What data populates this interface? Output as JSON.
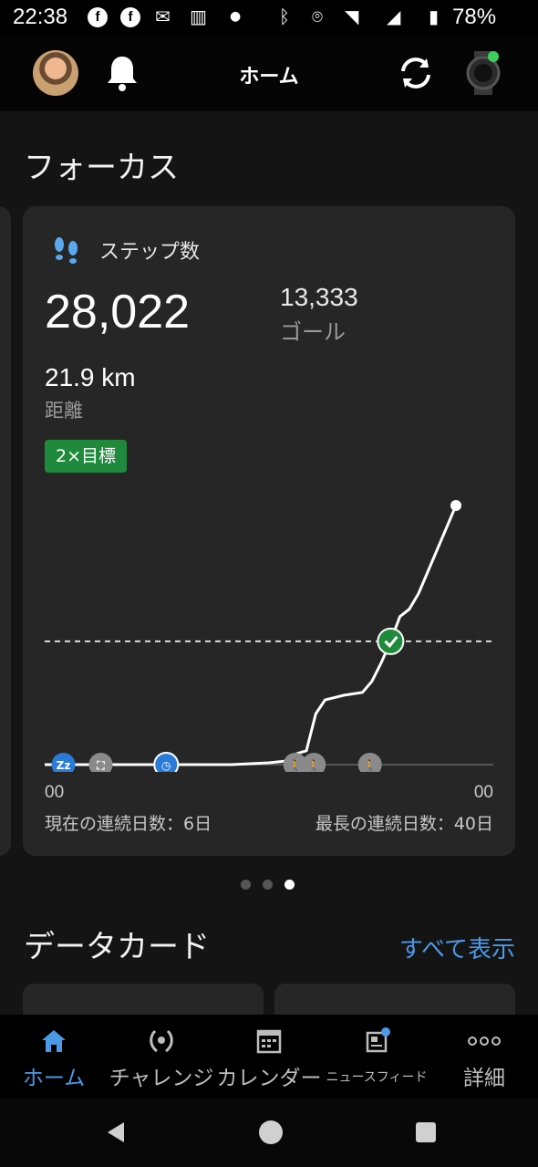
{
  "status_bar": {
    "time": "22:38",
    "battery": "78%"
  },
  "header": {
    "title": "ホーム"
  },
  "focus": {
    "section_title": "フォーカス",
    "card": {
      "title": "ステップ数",
      "steps": "28,022",
      "goal_value": "13,333",
      "goal_label": "ゴール",
      "distance_value": "21.9 km",
      "distance_label": "距離",
      "badge": "2×目標",
      "axis_start": "00",
      "axis_end": "00",
      "current_streak": "現在の連続日数：6日",
      "longest_streak": "最長の連続日数：40日"
    },
    "pager": {
      "count": 3,
      "active_index": 2
    }
  },
  "data_cards": {
    "section_title": "データカード",
    "see_all": "すべて表示"
  },
  "bottom_nav": {
    "items": [
      {
        "label": "ホーム",
        "icon": "home-icon",
        "active": true
      },
      {
        "label": "チャレンジ",
        "icon": "laurel-icon",
        "active": false
      },
      {
        "label": "カレンダー",
        "icon": "calendar-icon",
        "active": false
      },
      {
        "label": "ニュースフィード",
        "icon": "newsfeed-icon",
        "active": false
      },
      {
        "label": "詳細",
        "icon": "more-icon",
        "active": false
      }
    ]
  },
  "colors": {
    "accent": "#4a9ae8",
    "goal_green": "#1f8a3c",
    "card_bg": "#262626"
  },
  "chart_data": {
    "type": "line",
    "x_label_start": "00",
    "x_label_end": "00",
    "goal": 13333,
    "final_steps": 28022,
    "series": [
      {
        "values": [
          [
            0,
            0
          ],
          [
            2,
            0
          ],
          [
            4,
            0
          ],
          [
            6,
            0
          ],
          [
            8,
            0
          ],
          [
            10,
            0
          ],
          [
            12,
            200
          ],
          [
            13,
            400
          ],
          [
            13.5,
            1200
          ],
          [
            14,
            1500
          ],
          [
            14.5,
            5500
          ],
          [
            15,
            7000
          ],
          [
            16,
            7500
          ],
          [
            17,
            7800
          ],
          [
            17.5,
            9000
          ],
          [
            18,
            11000
          ],
          [
            18.5,
            13300
          ],
          [
            19,
            16000
          ],
          [
            19.5,
            16800
          ],
          [
            20,
            18500
          ],
          [
            22,
            28022
          ]
        ]
      }
    ],
    "events": [
      {
        "x": 1,
        "icon": "sleep-icon"
      },
      {
        "x": 3,
        "icon": "stair-icon"
      },
      {
        "x": 6.5,
        "icon": "clock-icon"
      },
      {
        "x": 13.4,
        "icon": "walk-icon"
      },
      {
        "x": 14.4,
        "icon": "walk-icon"
      },
      {
        "x": 17.4,
        "icon": "walk-icon"
      }
    ]
  }
}
